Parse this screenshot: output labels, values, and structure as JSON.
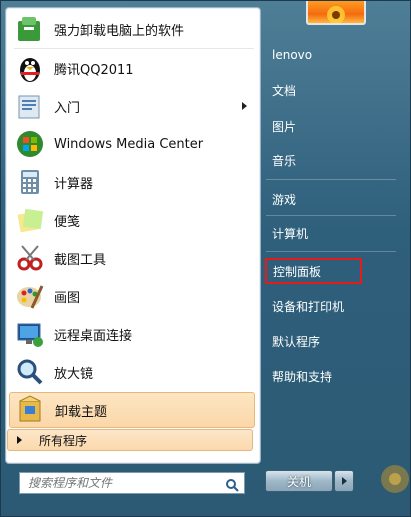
{
  "programs": [
    {
      "label": "强力卸载电脑上的软件",
      "icon": "uninstaller-icon"
    },
    {
      "label": "腾讯QQ2011",
      "icon": "qq-penguin-icon"
    },
    {
      "label": "入门",
      "icon": "getting-started-icon",
      "has_submenu": true
    },
    {
      "label": "Windows Media Center",
      "icon": "windows-media-center-icon"
    },
    {
      "label": "计算器",
      "icon": "calculator-icon"
    },
    {
      "label": "便笺",
      "icon": "sticky-notes-icon"
    },
    {
      "label": "截图工具",
      "icon": "snipping-tool-icon"
    },
    {
      "label": "画图",
      "icon": "paint-icon"
    },
    {
      "label": "远程桌面连接",
      "icon": "remote-desktop-icon"
    },
    {
      "label": "放大镜",
      "icon": "magnifier-icon"
    },
    {
      "label": "卸载主题",
      "icon": "uninstall-theme-icon",
      "highlighted": true
    }
  ],
  "all_programs_label": "所有程序",
  "search": {
    "placeholder": "搜索程序和文件"
  },
  "right_items": [
    {
      "label": "lenovo"
    },
    {
      "label": "文档"
    },
    {
      "label": "图片"
    },
    {
      "label": "音乐"
    },
    {
      "label": "游戏"
    },
    {
      "label": "计算机"
    },
    {
      "label": "控制面板",
      "boxed": true
    },
    {
      "label": "设备和打印机"
    },
    {
      "label": "默认程序"
    },
    {
      "label": "帮助和支持"
    }
  ],
  "shutdown_label": "关机",
  "colors": {
    "highlight_box": "#e41b1b",
    "panel_bg": "#2e5f7b",
    "hover_orange": "#fbd7a8"
  }
}
